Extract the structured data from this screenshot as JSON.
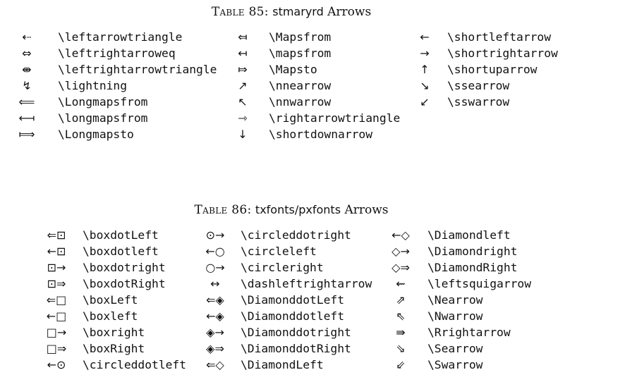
{
  "tables": [
    {
      "caption_prefix": "Table 85:",
      "caption_pkg": "stmaryrd",
      "caption_suffix": "Arrows",
      "columns": [
        [
          {
            "symbol": "⇠",
            "command": "\\leftarrowtriangle"
          },
          {
            "symbol": "⇔",
            "command": "\\leftrightarroweq"
          },
          {
            "symbol": "⇼",
            "command": "\\leftrightarrowtriangle"
          },
          {
            "symbol": "↯",
            "command": "\\lightning"
          },
          {
            "symbol": "⟸",
            "command": "\\Longmapsfrom"
          },
          {
            "symbol": "⟻",
            "command": "\\longmapsfrom"
          },
          {
            "symbol": "⟾",
            "command": "\\Longmapsto"
          }
        ],
        [
          {
            "symbol": "⤆",
            "command": "\\Mapsfrom"
          },
          {
            "symbol": "↤",
            "command": "\\mapsfrom"
          },
          {
            "symbol": "⤇",
            "command": "\\Mapsto"
          },
          {
            "symbol": "↗",
            "command": "\\nnearrow"
          },
          {
            "symbol": "↖",
            "command": "\\nnwarrow"
          },
          {
            "symbol": "⇾",
            "command": "\\rightarrowtriangle"
          },
          {
            "symbol": "↓",
            "command": "\\shortdownarrow"
          }
        ],
        [
          {
            "symbol": "←",
            "command": "\\shortleftarrow"
          },
          {
            "symbol": "→",
            "command": "\\shortrightarrow"
          },
          {
            "symbol": "↑",
            "command": "\\shortuparrow"
          },
          {
            "symbol": "↘",
            "command": "\\ssearrow"
          },
          {
            "symbol": "↙",
            "command": "\\sswarrow"
          }
        ]
      ]
    },
    {
      "caption_prefix": "Table 86:",
      "caption_pkg": "txfonts/pxfonts",
      "caption_suffix": "Arrows",
      "columns": [
        [
          {
            "symbol": "⇐⊡",
            "command": "\\boxdotLeft"
          },
          {
            "symbol": "←⊡",
            "command": "\\boxdotleft"
          },
          {
            "symbol": "⊡→",
            "command": "\\boxdotright"
          },
          {
            "symbol": "⊡⇒",
            "command": "\\boxdotRight"
          },
          {
            "symbol": "⇐□",
            "command": "\\boxLeft"
          },
          {
            "symbol": "←□",
            "command": "\\boxleft"
          },
          {
            "symbol": "□→",
            "command": "\\boxright"
          },
          {
            "symbol": "□⇒",
            "command": "\\boxRight"
          },
          {
            "symbol": "←⊙",
            "command": "\\circleddotleft"
          }
        ],
        [
          {
            "symbol": "⊙→",
            "command": "\\circleddotright"
          },
          {
            "symbol": "←○",
            "command": "\\circleleft"
          },
          {
            "symbol": "○→",
            "command": "\\circleright"
          },
          {
            "symbol": "↔",
            "command": "\\dashleftrightarrow"
          },
          {
            "symbol": "⇐◈",
            "command": "\\DiamonddotLeft"
          },
          {
            "symbol": "←◈",
            "command": "\\Diamonddotleft"
          },
          {
            "symbol": "◈→",
            "command": "\\Diamonddotright"
          },
          {
            "symbol": "◈⇒",
            "command": "\\DiamonddotRight"
          },
          {
            "symbol": "⇐◇",
            "command": "\\DiamondLeft"
          }
        ],
        [
          {
            "symbol": "←◇",
            "command": "\\Diamondleft"
          },
          {
            "symbol": "◇→",
            "command": "\\Diamondright"
          },
          {
            "symbol": "◇⇒",
            "command": "\\DiamondRight"
          },
          {
            "symbol": "⇜",
            "command": "\\leftsquigarrow"
          },
          {
            "symbol": "⇗",
            "command": "\\Nearrow"
          },
          {
            "symbol": "⇖",
            "command": "\\Nwarrow"
          },
          {
            "symbol": "⇛",
            "command": "\\Rrightarrow"
          },
          {
            "symbol": "⇘",
            "command": "\\Searrow"
          },
          {
            "symbol": "⇙",
            "command": "\\Swarrow"
          }
        ]
      ]
    }
  ]
}
